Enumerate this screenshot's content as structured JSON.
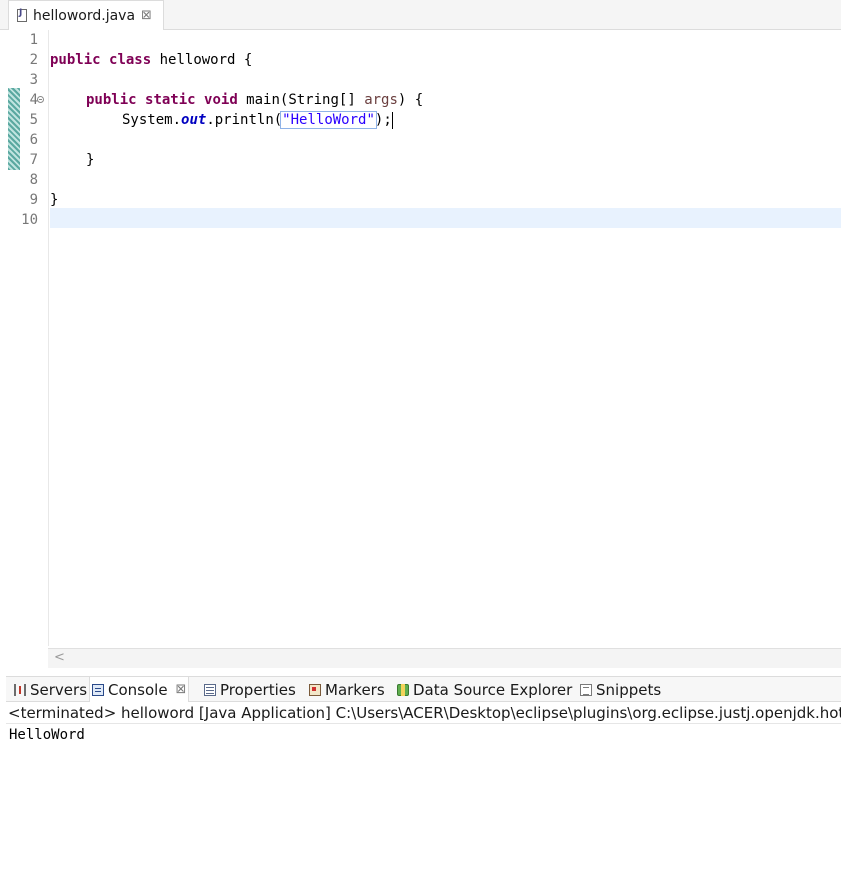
{
  "editor": {
    "tab": {
      "label": "helloword.java",
      "close": "⊠"
    },
    "line_numbers": [
      "1",
      "2",
      "3",
      "4",
      "5",
      "6",
      "7",
      "8",
      "9",
      "10"
    ],
    "code": {
      "line2": {
        "kw1": "public",
        "kw2": "class",
        "rest": " helloword {"
      },
      "line4": {
        "kw1": "public",
        "kw2": "static",
        "kw3": "void",
        "sig": " main(String[] ",
        "param": "args",
        "rest": ") {"
      },
      "line5": {
        "prefix": "System.",
        "field": "out",
        "call": ".println(",
        "string": "\"HelloWord\"",
        "rest": ");"
      },
      "line7": "}",
      "line9": "}"
    },
    "scroll_left": "<"
  },
  "panel": {
    "tabs": [
      {
        "label": "Servers",
        "icon": "servers-icon"
      },
      {
        "label": "Console",
        "icon": "console-icon",
        "close": "⊠",
        "active": true
      },
      {
        "label": "Properties",
        "icon": "properties-icon"
      },
      {
        "label": "Markers",
        "icon": "markers-icon"
      },
      {
        "label": "Data Source Explorer",
        "icon": "datasource-icon"
      },
      {
        "label": "Snippets",
        "icon": "snippets-icon"
      }
    ]
  },
  "console": {
    "header": "<terminated> helloword [Java Application] C:\\Users\\ACER\\Desktop\\eclipse\\plugins\\org.eclipse.justj.openjdk.hotsp",
    "output": "HelloWord"
  }
}
